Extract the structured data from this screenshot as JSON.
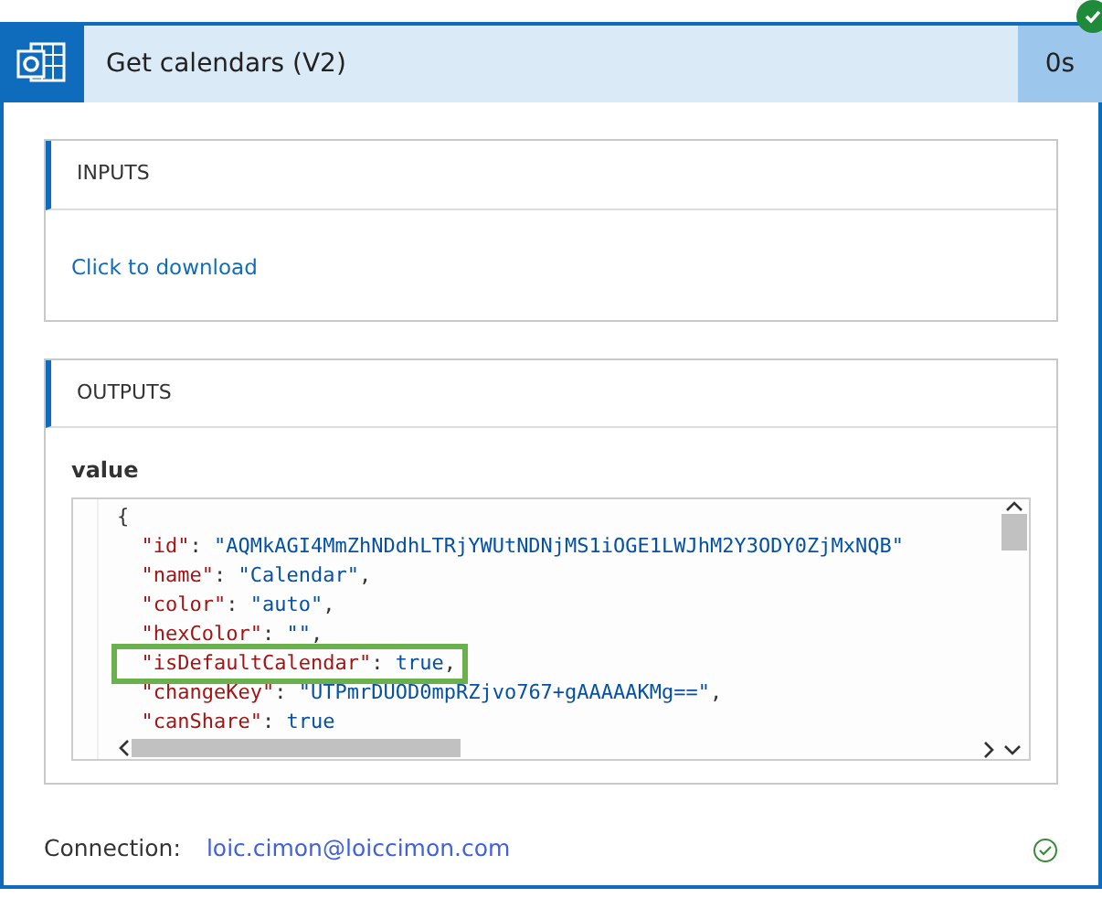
{
  "action": {
    "title": "Get calendars (V2)",
    "duration": "0s",
    "succeeded": true
  },
  "inputs": {
    "heading": "INPUTS",
    "link": "Click to download"
  },
  "outputs": {
    "heading": "OUTPUTS",
    "label": "value",
    "lines": [
      {
        "kind": "brace",
        "text": "{"
      },
      {
        "kind": "pair",
        "key": "\"id\"",
        "sep": ":",
        "value": "\"AQMkAGI4MmZhNDdhLTRjYWUtNDNjMS1iOGE1LWJhM2Y3ODY0ZjMxNQB\"",
        "highlighted": false
      },
      {
        "kind": "pair",
        "key": "\"name\"",
        "sep": ":",
        "value": "\"Calendar\"",
        "punct": ",",
        "highlighted": false
      },
      {
        "kind": "pair",
        "key": "\"color\"",
        "sep": ":",
        "value": "\"auto\"",
        "punct": ",",
        "highlighted": false
      },
      {
        "kind": "pair",
        "key": "\"hexColor\"",
        "sep": ":",
        "value": "\"\"",
        "punct": ",",
        "highlighted": false
      },
      {
        "kind": "pair",
        "key": "\"isDefaultCalendar\"",
        "sep": ":",
        "value": "true",
        "punct": ",",
        "highlighted": true
      },
      {
        "kind": "pair",
        "key": "\"changeKey\"",
        "sep": ":",
        "value": "\"UTPmrDUOD0mpRZjvo767+gAAAAAKMg==\"",
        "punct": ",",
        "highlighted": false
      },
      {
        "kind": "pair",
        "key": "\"canShare\"",
        "sep": ":",
        "value": "true",
        "highlighted": false
      }
    ]
  },
  "connection": {
    "label": "Connection:",
    "account": "loic.cimon@loiccimon.com",
    "ok": true
  }
}
